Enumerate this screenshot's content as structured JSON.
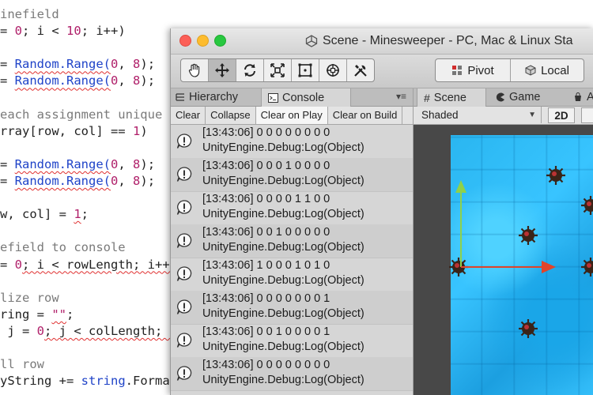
{
  "editor": {
    "lines": [
      {
        "segments": [
          {
            "t": "inefield",
            "c": "c"
          }
        ]
      },
      {
        "segments": [
          {
            "t": "= ",
            "c": ""
          },
          {
            "t": "0",
            "c": "m"
          },
          {
            "t": "; i < ",
            "c": ""
          },
          {
            "t": "10",
            "c": "m"
          },
          {
            "t": "; i++)",
            "c": ""
          }
        ]
      },
      {
        "segments": []
      },
      {
        "segments": [
          {
            "t": "= ",
            "c": ""
          },
          {
            "t": "Random.Range(",
            "c": "n sq"
          },
          {
            "t": "0",
            "c": "m"
          },
          {
            "t": ", ",
            "c": ""
          },
          {
            "t": "8",
            "c": "m"
          },
          {
            "t": ");",
            "c": ""
          }
        ]
      },
      {
        "segments": [
          {
            "t": "= ",
            "c": ""
          },
          {
            "t": "Random.Range(",
            "c": "n sq"
          },
          {
            "t": "0",
            "c": "m"
          },
          {
            "t": ", ",
            "c": ""
          },
          {
            "t": "8",
            "c": "m"
          },
          {
            "t": ");",
            "c": ""
          }
        ]
      },
      {
        "segments": []
      },
      {
        "segments": [
          {
            "t": "each assignment unique",
            "c": "c"
          }
        ]
      },
      {
        "segments": [
          {
            "t": "rray[row, col] == ",
            "c": ""
          },
          {
            "t": "1",
            "c": "m"
          },
          {
            "t": ")",
            "c": ""
          }
        ]
      },
      {
        "segments": []
      },
      {
        "segments": [
          {
            "t": "= ",
            "c": ""
          },
          {
            "t": "Random.Range(",
            "c": "n sq"
          },
          {
            "t": "0",
            "c": "m"
          },
          {
            "t": ", ",
            "c": ""
          },
          {
            "t": "8",
            "c": "m"
          },
          {
            "t": ");",
            "c": ""
          }
        ]
      },
      {
        "segments": [
          {
            "t": "= ",
            "c": ""
          },
          {
            "t": "Random.Range(",
            "c": "n sq"
          },
          {
            "t": "0",
            "c": "m"
          },
          {
            "t": ", ",
            "c": ""
          },
          {
            "t": "8",
            "c": "m"
          },
          {
            "t": ");",
            "c": ""
          }
        ]
      },
      {
        "segments": []
      },
      {
        "segments": [
          {
            "t": "w, col] = ",
            "c": ""
          },
          {
            "t": "1",
            "c": "m sq"
          },
          {
            "t": ";",
            "c": ""
          }
        ]
      },
      {
        "segments": []
      },
      {
        "segments": [
          {
            "t": "efield to console",
            "c": "c"
          }
        ]
      },
      {
        "segments": [
          {
            "t": "= ",
            "c": ""
          },
          {
            "t": "0",
            "c": "m"
          },
          {
            "t": "; i < rowLength; i++)",
            "c": "sq"
          }
        ]
      },
      {
        "segments": []
      },
      {
        "segments": [
          {
            "t": "lize row",
            "c": "c"
          }
        ]
      },
      {
        "segments": [
          {
            "t": "ring = ",
            "c": ""
          },
          {
            "t": "\"\"",
            "c": "s sq"
          },
          {
            "t": ";",
            "c": ""
          }
        ]
      },
      {
        "segments": [
          {
            "t": " j = ",
            "c": ""
          },
          {
            "t": "0",
            "c": "m"
          },
          {
            "t": "; j < colLength; j++)",
            "c": "sq"
          }
        ]
      },
      {
        "segments": []
      },
      {
        "segments": [
          {
            "t": "ll row",
            "c": "c"
          }
        ]
      },
      {
        "segments": [
          {
            "t": "yString += ",
            "c": ""
          },
          {
            "t": "string",
            "c": "k"
          },
          {
            "t": ".Format(",
            "c": ""
          }
        ]
      }
    ]
  },
  "window": {
    "title": "Scene - Minesweeper - PC, Mac & Linux Sta"
  },
  "toolbar": {
    "tools": [
      {
        "name": "hand-tool",
        "icon": "hand-icon"
      },
      {
        "name": "move-tool",
        "icon": "move-arrows-icon"
      },
      {
        "name": "rotate-tool",
        "icon": "rotate-icon"
      },
      {
        "name": "scale-tool",
        "icon": "scale-icon"
      },
      {
        "name": "rect-tool",
        "icon": "rect-transform-icon"
      },
      {
        "name": "transform-tool",
        "icon": "transform-icon"
      },
      {
        "name": "custom-tool",
        "icon": "tools-icon"
      }
    ],
    "pivot_label": "Pivot",
    "local_label": "Local"
  },
  "left_panel": {
    "tab_hierarchy": "Hierarchy",
    "tab_console": "Console",
    "console_buttons": [
      "Clear",
      "Collapse",
      "Clear on Play",
      "Clear on Build"
    ],
    "logs": [
      {
        "line1": "[13:43:06] 0 0 0 0 0 0 0 0",
        "line2": "UnityEngine.Debug:Log(Object)"
      },
      {
        "line1": "[13:43:06] 0 0 0 1 0 0 0 0",
        "line2": "UnityEngine.Debug:Log(Object)"
      },
      {
        "line1": "[13:43:06] 0 0 0 0 1 1 0 0",
        "line2": "UnityEngine.Debug:Log(Object)"
      },
      {
        "line1": "[13:43:06] 0 0 1 0 0 0 0 0",
        "line2": "UnityEngine.Debug:Log(Object)"
      },
      {
        "line1": "[13:43:06] 1 0 0 0 1 0 1 0",
        "line2": "UnityEngine.Debug:Log(Object)"
      },
      {
        "line1": "[13:43:06] 0 0 0 0 0 0 0 1",
        "line2": "UnityEngine.Debug:Log(Object)"
      },
      {
        "line1": "[13:43:06] 0 0 1 0 0 0 0 1",
        "line2": "UnityEngine.Debug:Log(Object)"
      },
      {
        "line1": "[13:43:06] 0 0 0 0 0 0 0 0",
        "line2": "UnityEngine.Debug:Log(Object)"
      }
    ]
  },
  "scene_panel": {
    "tab_scene": "Scene",
    "tab_game": "Game",
    "tab_asset": "A",
    "shaded_label": "Shaded",
    "btn_2d": "2D"
  }
}
